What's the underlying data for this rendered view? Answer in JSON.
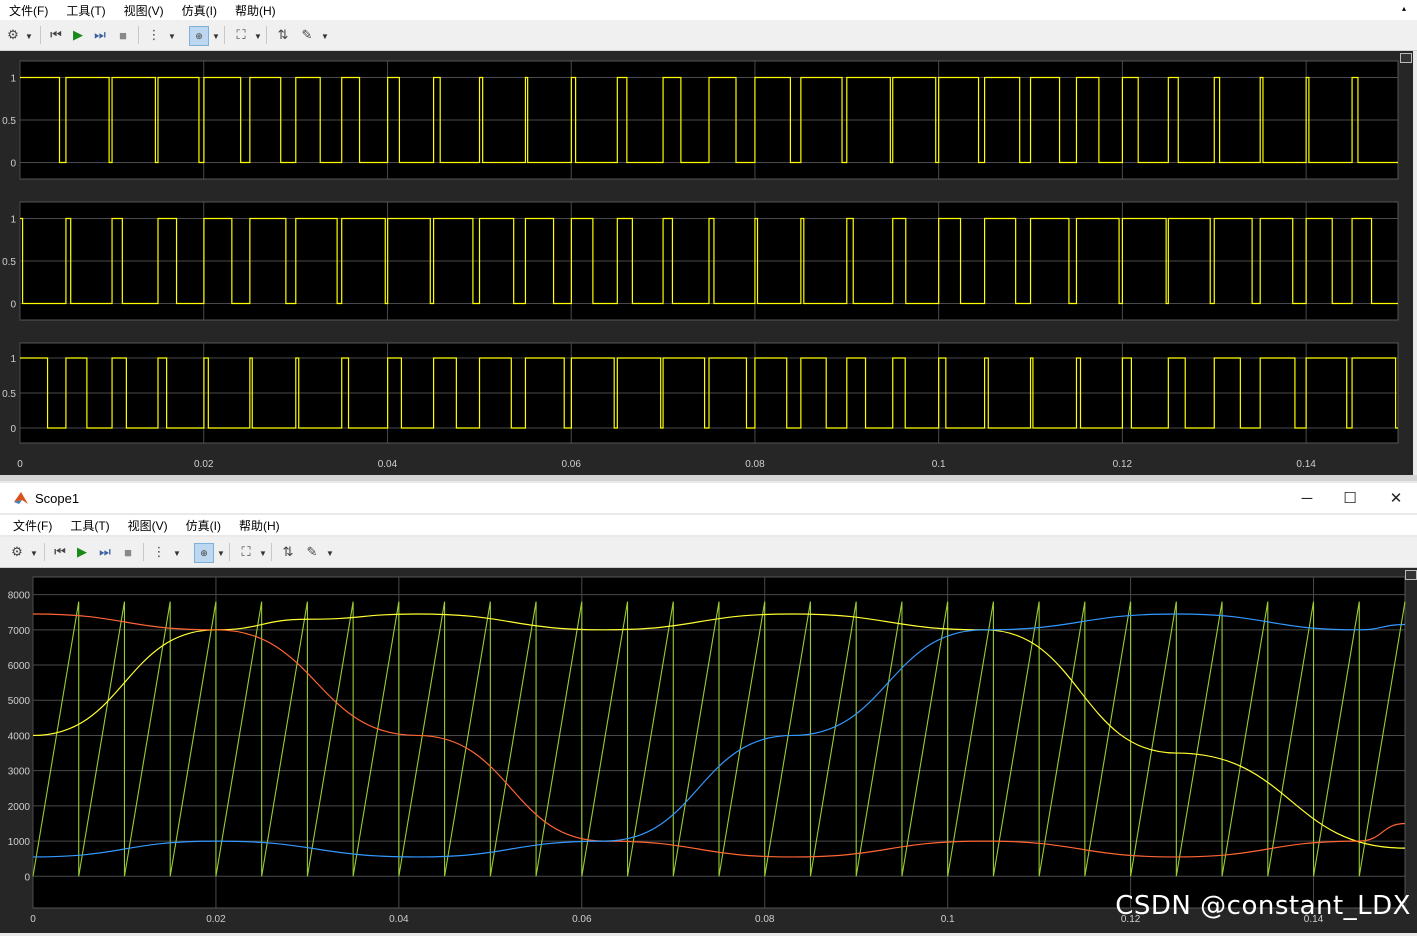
{
  "window1": {
    "menu": [
      "文件(F)",
      "工具(T)",
      "视图(V)",
      "仿真(I)",
      "帮助(H)"
    ],
    "x_ticks": [
      "0",
      "0.02",
      "0.04",
      "0.06",
      "0.08",
      "0.1",
      "0.12",
      "0.14"
    ],
    "y_ticks": [
      "1",
      "0.5",
      "0"
    ]
  },
  "window2": {
    "title": "Scope1",
    "menu": [
      "文件(F)",
      "工具(T)",
      "视图(V)",
      "仿真(I)",
      "帮助(H)"
    ],
    "x_ticks": [
      "0",
      "0.02",
      "0.04",
      "0.06",
      "0.08",
      "0.1",
      "0.12",
      "0.14"
    ],
    "y_ticks": [
      "8000",
      "7000",
      "6000",
      "5000",
      "4000",
      "3000",
      "2000",
      "1000",
      "0"
    ]
  },
  "icons": {
    "settings": "gear-icon",
    "step_back": "step-back-icon",
    "run": "run-icon",
    "step_forward": "step-forward-icon",
    "stop": "stop-icon",
    "signals": "signal-select-icon",
    "zoom": "zoom-icon",
    "fit": "fit-to-view-icon",
    "triggers": "trigger-icon",
    "cursor": "cursor-measure-icon",
    "minimize": "minimize-icon",
    "maximize": "maximize-icon",
    "close": "close-icon"
  },
  "watermark": "CSDN @constant_LDX",
  "chart_data": [
    {
      "type": "line",
      "title": "",
      "xlim": [
        0,
        0.15
      ],
      "ylim": [
        -0.1,
        1.1
      ],
      "color": "#ffff00",
      "series": [
        {
          "name": "",
          "values": "PWM pulse train 0/1, carrier period 0.005 s"
        }
      ]
    },
    {
      "type": "line",
      "title": "",
      "xlim": [
        0,
        0.15
      ],
      "ylim": [
        -0.1,
        1.1
      ],
      "color": "#ffff00",
      "series": [
        {
          "name": "",
          "values": "PWM pulse train 0/1, carrier period 0.005 s"
        }
      ]
    },
    {
      "type": "line",
      "title": "",
      "xlim": [
        0,
        0.15
      ],
      "ylim": [
        -0.1,
        1.1
      ],
      "color": "#ffff00",
      "series": [
        {
          "name": "",
          "values": "PWM pulse train 0/1, carrier period 0.005 s"
        }
      ]
    },
    {
      "type": "line",
      "title": "",
      "xlim": [
        0,
        0.15
      ],
      "ylim": [
        -900,
        8500
      ],
      "series": [
        {
          "name": "",
          "color": "#9acd32",
          "values": "sawtooth carrier 0 to 7800, period 0.005 s"
        },
        {
          "name": "",
          "color": "#ffff33",
          "x": [
            0,
            0.02,
            0.03,
            0.042,
            0.0625,
            0.083,
            0.104,
            0.125,
            0.15
          ],
          "y": [
            4000,
            7000,
            7300,
            7450,
            7000,
            7450,
            7000,
            3500,
            800
          ]
        },
        {
          "name": "",
          "color": "#ff6633",
          "x": [
            0,
            0.02,
            0.042,
            0.0625,
            0.083,
            0.104,
            0.125,
            0.145,
            0.15
          ],
          "y": [
            7450,
            7000,
            4000,
            1000,
            550,
            1000,
            550,
            1000,
            1500
          ]
        },
        {
          "name": "",
          "color": "#3399ff",
          "x": [
            0,
            0.02,
            0.042,
            0.0625,
            0.083,
            0.104,
            0.125,
            0.145,
            0.15
          ],
          "y": [
            550,
            1000,
            550,
            1000,
            4000,
            7000,
            7450,
            7000,
            7150
          ]
        }
      ]
    }
  ]
}
